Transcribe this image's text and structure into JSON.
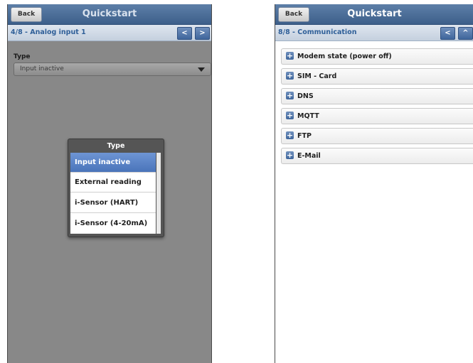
{
  "left_screen": {
    "back_label": "Back",
    "title": "Quickstart",
    "step": "4/8 - Analog input 1",
    "prev_label": "<",
    "next_label": ">",
    "type_label": "Type",
    "type_value": "Input inactive",
    "popup": {
      "title": "Type",
      "options": [
        "Input inactive",
        "External reading",
        "i-Sensor (HART)",
        "i-Sensor (4-20mA)"
      ],
      "selected": "Input inactive"
    }
  },
  "right_screen": {
    "back_label": "Back",
    "title": "Quickstart",
    "step": "8/8 - Communication",
    "prev_label": "<",
    "up_label": "^",
    "sections": [
      "Modem state (power off)",
      "SIM - Card",
      "DNS",
      "MQTT",
      "FTP",
      "E-Mail"
    ],
    "expand_symbol": "+"
  },
  "colors": {
    "header_blue": "#3d5f8a",
    "subheader_text": "#2f5f98",
    "selected_item": "#4a74ba",
    "dimmed_overlay": "#888888"
  },
  "icons": [
    "chevron-left-icon",
    "chevron-right-icon",
    "chevron-up-icon",
    "dropdown-arrow-icon",
    "plus-icon"
  ]
}
